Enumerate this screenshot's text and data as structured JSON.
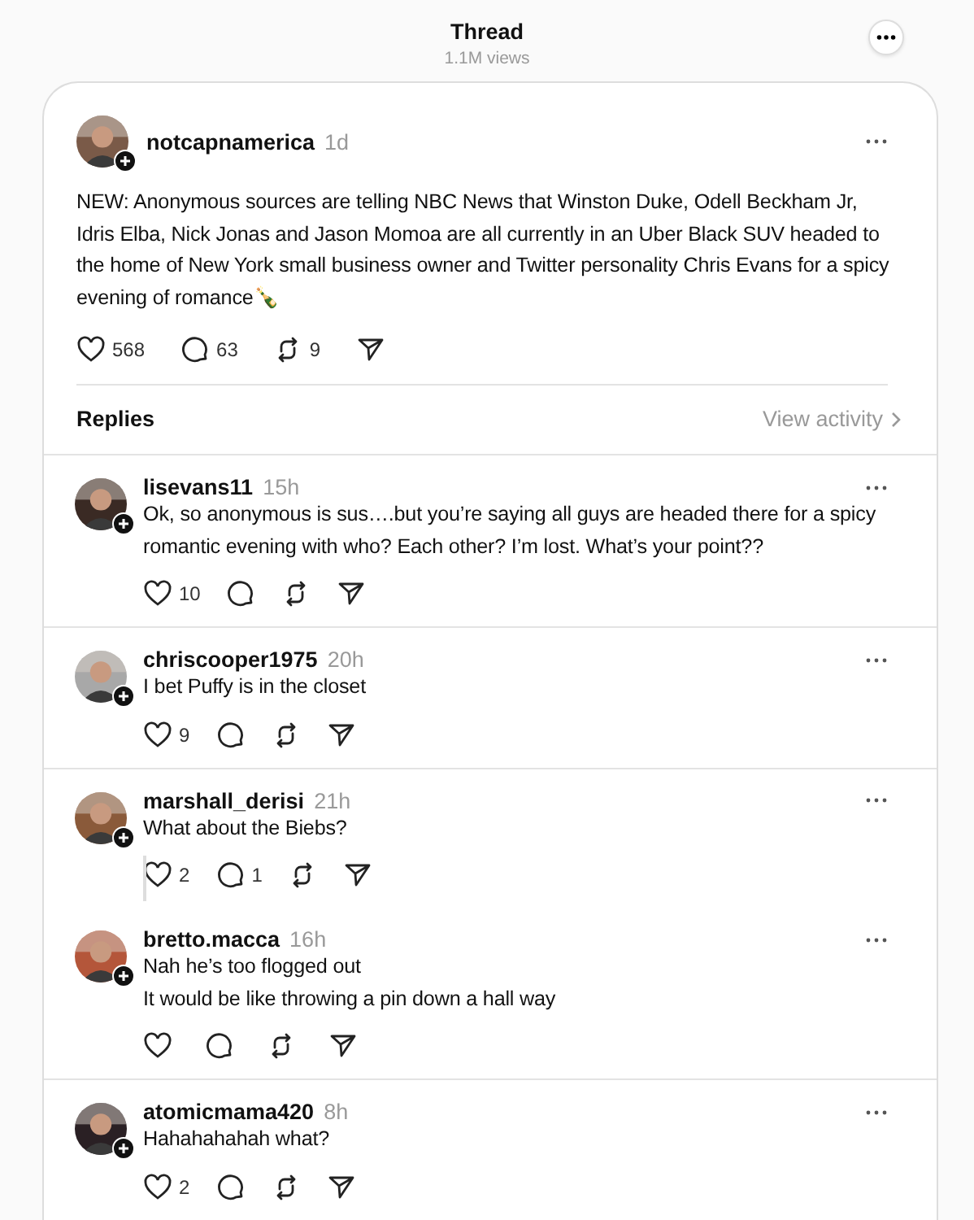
{
  "header": {
    "title": "Thread",
    "views": "1.1M views"
  },
  "post": {
    "user": "notcapnamerica",
    "time": "1d",
    "text": "NEW: Anonymous sources are telling NBC News that Winston Duke, Odell Beckham Jr, Idris Elba, Nick Jonas and Jason Momoa are all currently in an Uber Black SUV headed to the home of New York small business owner and Twitter personality Chris Evans for a spicy evening of romance🍾",
    "likes": "568",
    "comments": "63",
    "reposts": "9"
  },
  "replies_bar": {
    "label": "Replies",
    "link": "View activity"
  },
  "replies": [
    {
      "user": "lisevans11",
      "time": "15h",
      "lines": [
        "Ok, so anonymous is sus….but you’re saying all guys are headed there for a spicy romantic evening with who? Each other? I’m lost. What’s your point??"
      ],
      "likes": "10"
    },
    {
      "user": "chriscooper1975",
      "time": "20h",
      "lines": [
        "I bet Puffy is in the closet"
      ],
      "likes": "9"
    },
    {
      "user": "marshall_derisi",
      "time": "21h",
      "lines": [
        "What about the Biebs?"
      ],
      "likes": "2",
      "comments": "1",
      "children": [
        {
          "user": "bretto.macca",
          "time": "16h",
          "lines": [
            "Nah he’s too flogged out",
            "It would be like throwing a pin down a hall way"
          ]
        }
      ]
    },
    {
      "user": "atomicmama420",
      "time": "8h",
      "lines": [
        "Hahahahahah what?"
      ],
      "likes": "2"
    }
  ]
}
